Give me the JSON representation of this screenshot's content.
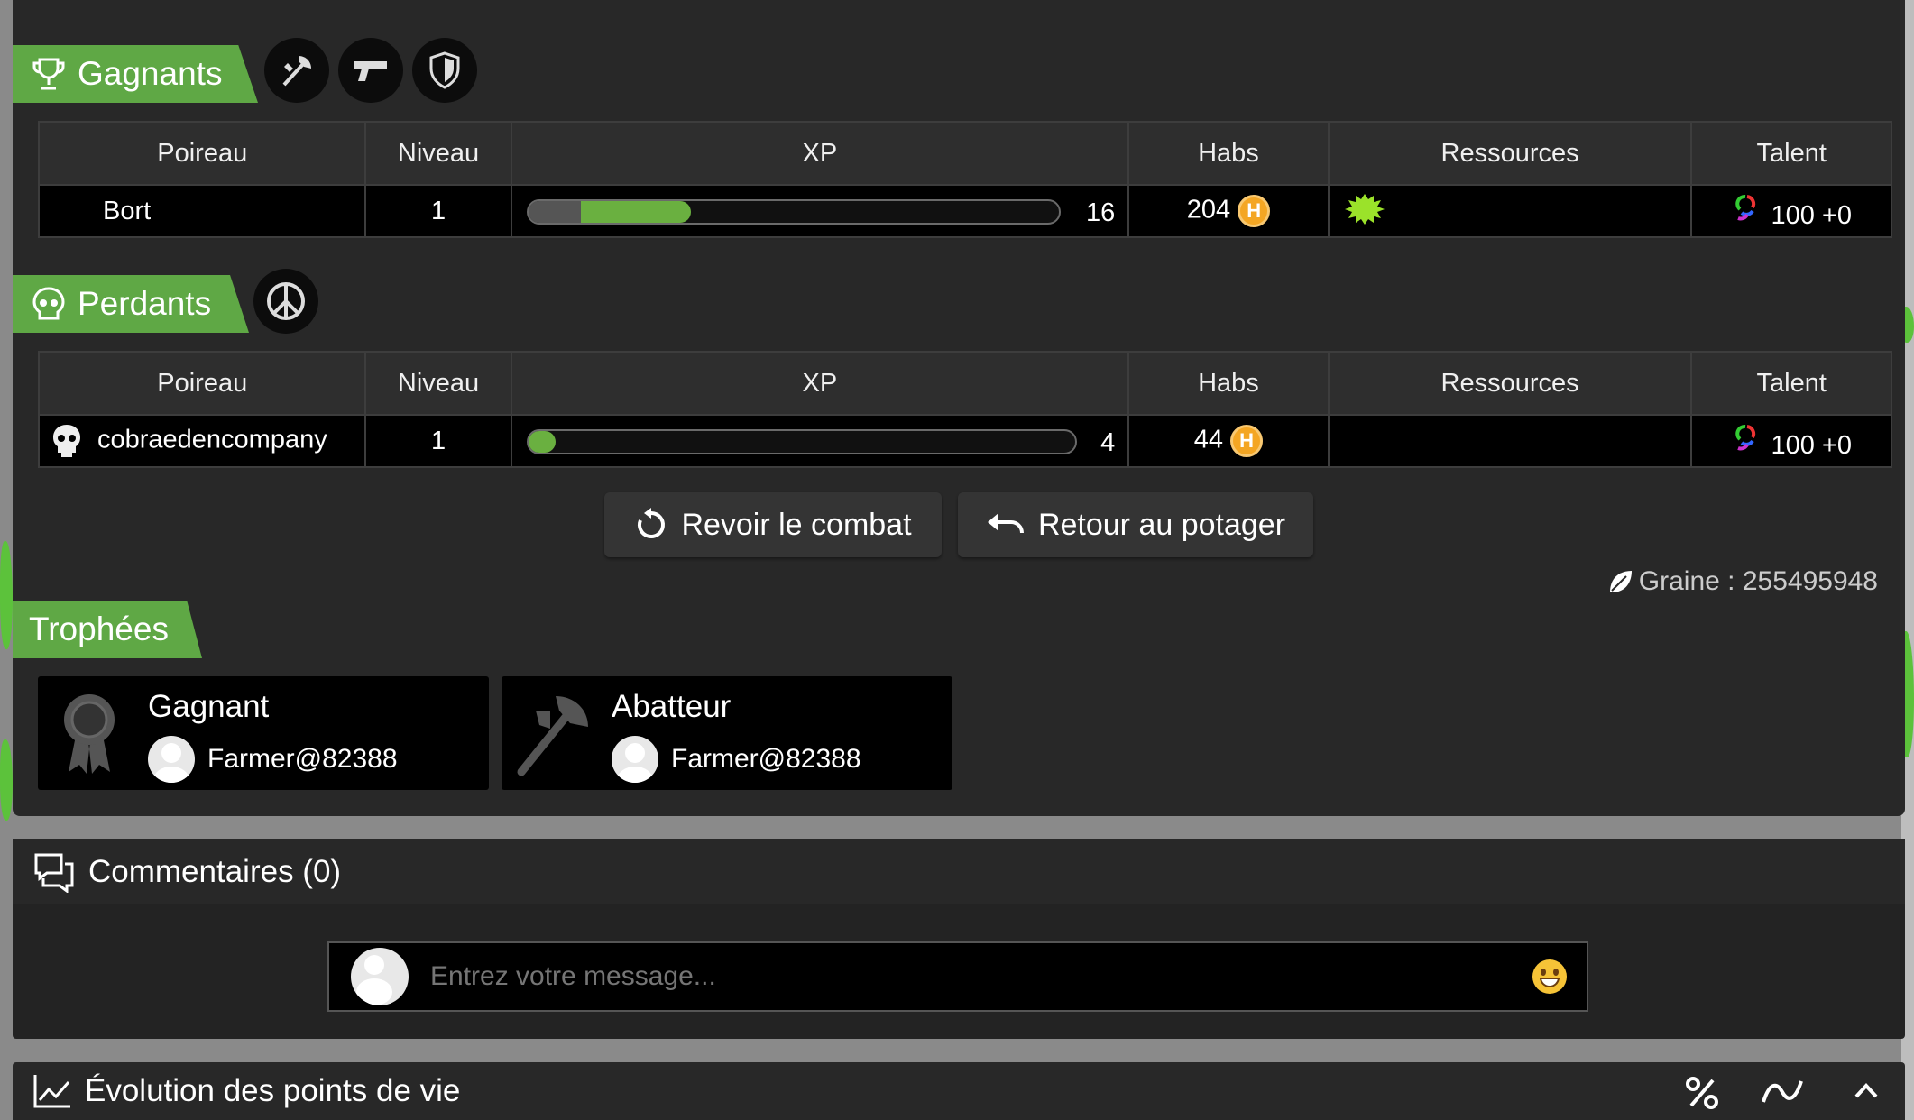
{
  "winners": {
    "label": "Gagnants",
    "icons": [
      "axe-icon",
      "gun-icon",
      "shield-icon"
    ],
    "headers": [
      "Poireau",
      "Niveau",
      "XP",
      "Habs",
      "Ressources",
      "Talent"
    ],
    "rows": [
      {
        "name": "Bort",
        "level": "1",
        "xp": "16",
        "xp_fill": 0.3,
        "habs": "204",
        "talent": "100 +0"
      }
    ]
  },
  "losers": {
    "label": "Perdants",
    "icons": [
      "peace-icon"
    ],
    "headers": [
      "Poireau",
      "Niveau",
      "XP",
      "Habs",
      "Ressources",
      "Talent"
    ],
    "rows": [
      {
        "name": "cobraedencompany",
        "level": "1",
        "xp": "4",
        "xp_fill": 0.05,
        "habs": "44",
        "talent": "100 +0"
      }
    ]
  },
  "actions": {
    "replay": "Revoir le combat",
    "back": "Retour au potager"
  },
  "seed": "Graine : 255495948",
  "trophies": {
    "label": "Trophées",
    "items": [
      {
        "title": "Gagnant",
        "user": "Farmer@82388"
      },
      {
        "title": "Abatteur",
        "user": "Farmer@82388"
      }
    ]
  },
  "comments": {
    "title": "Commentaires (0)",
    "placeholder": "Entrez votre message..."
  },
  "hp_section": {
    "title": "Évolution des points de vie"
  },
  "colors": {
    "accent": "#5fa845",
    "background": "#282828",
    "xp_fill": "#6ab040",
    "coin": "#f4a623"
  }
}
